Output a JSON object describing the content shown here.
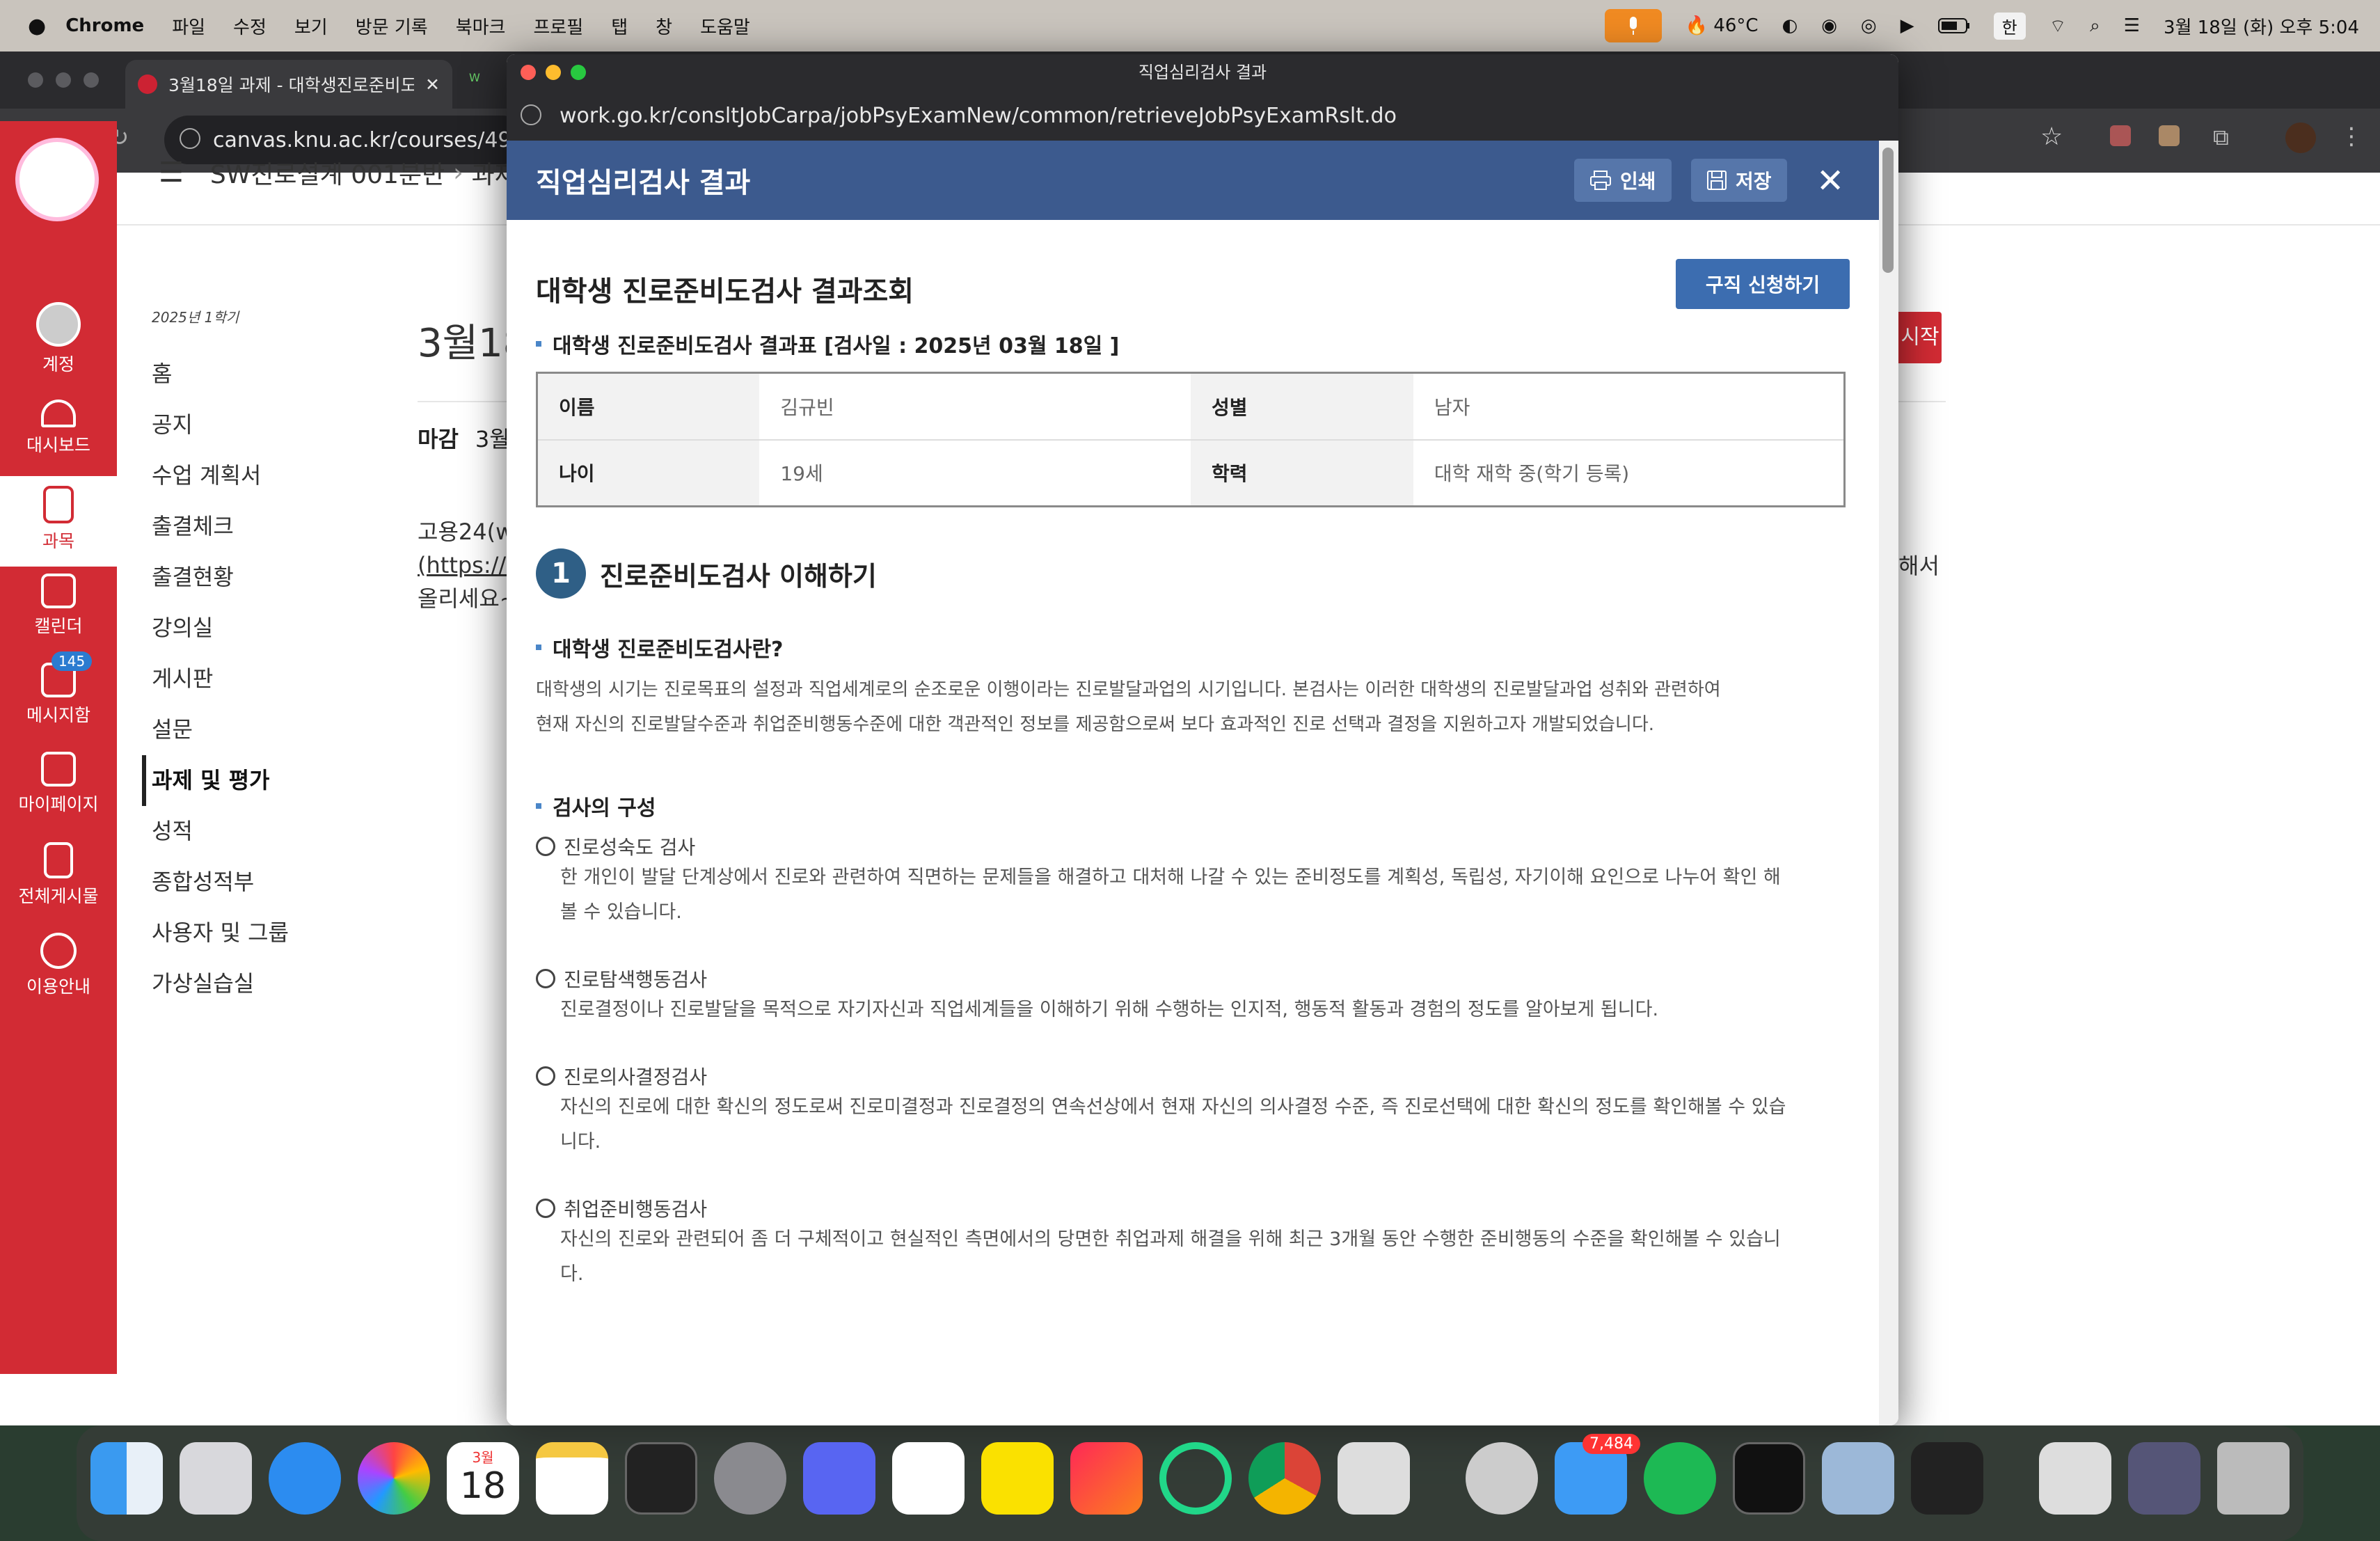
{
  "menubar": {
    "app": "Chrome",
    "menus": [
      "파일",
      "수정",
      "보기",
      "방문 기록",
      "북마크",
      "프로필",
      "탭",
      "창",
      "도움말"
    ],
    "temperature": "46°C",
    "input_method": "한",
    "datetime": "3월 18일 (화) 오후 5:04"
  },
  "browser": {
    "tab1_title": "3월18일 과제 - 대학생진로준비도",
    "url": "canvas.knu.ac.kr/courses/4905"
  },
  "lms": {
    "rail": [
      {
        "label": "계정",
        "icon": "account-icon"
      },
      {
        "label": "대시보드",
        "icon": "dashboard-icon"
      },
      {
        "label": "과목",
        "icon": "courses-icon"
      },
      {
        "label": "캘린더",
        "icon": "calendar-icon"
      },
      {
        "label": "메시지함",
        "icon": "inbox-icon",
        "badge": "145"
      },
      {
        "label": "마이페이지",
        "icon": "mypage-icon"
      },
      {
        "label": "전체게시물",
        "icon": "posts-icon"
      },
      {
        "label": "이용안내",
        "icon": "help-icon"
      }
    ],
    "breadcrumb": "SW진로설계 001분반",
    "breadcrumb_next": "과제",
    "term": "2025년 1학기",
    "nav": [
      "홈",
      "공지",
      "수업 계획서",
      "출결체크",
      "출결현황",
      "강의실",
      "게시판",
      "설문",
      "과제 및 평가",
      "성적",
      "종합성적부",
      "사용자 및 그룹",
      "가상실습실"
    ],
    "nav_selected": "과제 및 평가",
    "page_title": "3월18",
    "due_label": "마감",
    "due_value": "3월",
    "body_line1": "고용24(w",
    "body_line2": "(https://v",
    "body_line3": "올리세요~",
    "right_btn": "시작",
    "right_text": "해서"
  },
  "popup": {
    "window_title": "직업심리검사 결과",
    "url": "work.go.kr/consltJobCarpa/jobPsyExamNew/common/retrieveJobPsyExamRslt.do",
    "header": "직업심리검사 결과",
    "print": "인쇄",
    "save": "저장",
    "title": "대학생 진로준비도검사 결과조회",
    "apply": "구직 신청하기",
    "result_table_title": "대학생 진로준비도검사 결과표 [검사일 : 2025년 03월 18일 ]",
    "info": {
      "name_label": "이름",
      "name": "김규빈",
      "gender_label": "성별",
      "gender": "남자",
      "age_label": "나이",
      "age": "19세",
      "edu_label": "학력",
      "edu": "대학 재학 중(학기 등록)"
    },
    "section1_num": "1",
    "section1": "진로준비도검사 이해하기",
    "what_title": "대학생 진로준비도검사란?",
    "what_body1": "대학생의 시기는 진로목표의 설정과 직업세계로의 순조로운 이행이라는 진로발달과업의 시기입니다. 본검사는 이러한 대학생의 진로발달과업 성취와 관련하여",
    "what_body2": "현재 자신의 진로발달수준과 취업준비행동수준에 대한 객관적인 정보를 제공함으로써 보다 효과적인 진로 선택과 결정을 지원하고자 개발되었습니다.",
    "comp_title": "검사의 구성",
    "items": [
      {
        "name": "진로성숙도 검사",
        "desc1": "한 개인이 발달 단계상에서 진로와 관련하여 직면하는 문제들을 해결하고 대처해 나갈 수 있는 준비정도를 계획성, 독립성, 자기이해 요인으로 나누어 확인 해",
        "desc2": "볼 수 있습니다."
      },
      {
        "name": "진로탐색행동검사",
        "desc1": "진로결정이나 진로발달을 목적으로 자기자신과 직업세계들을 이해하기 위해 수행하는 인지적, 행동적 활동과 경험의 정도를 알아보게 됩니다.",
        "desc2": ""
      },
      {
        "name": "진로의사결정검사",
        "desc1": "자신의 진로에 대한 확신의 정도로써 진로미결정과 진로결정의 연속선상에서 현재 자신의 의사결정 수준, 즉 진로선택에 대한 확신의 정도를 확인해볼 수 있습",
        "desc2": "니다."
      },
      {
        "name": "취업준비행동검사",
        "desc1": "자신의 진로와 관련되어 좀 더 구체적이고 현실적인 측면에서의 당면한 취업과제 해결을 위해 최근 3개월 동안 수행한 준비행동의 수준을 확인해볼 수 있습니",
        "desc2": "다."
      }
    ]
  },
  "dock": {
    "calendar_month": "3월",
    "calendar_day": "18",
    "mail_badge": "7,484",
    "apps": [
      "finder-icon",
      "launchpad-icon",
      "safari-icon",
      "photos-icon",
      "calendar-icon",
      "notes-icon",
      "terminal-icon",
      "system-settings-icon",
      "discord-icon",
      "vscode-icon",
      "kakaotalk-icon",
      "intellij-icon",
      "pycharm-icon",
      "chrome-icon",
      "iphone-mirroring-icon",
      "disk-utility-icon",
      "mail-icon",
      "spotify-icon",
      "activity-monitor-icon",
      "preview-icon",
      "voice-memos-icon",
      "downloads-icon",
      "screenshots-icon",
      "trash-icon"
    ]
  }
}
